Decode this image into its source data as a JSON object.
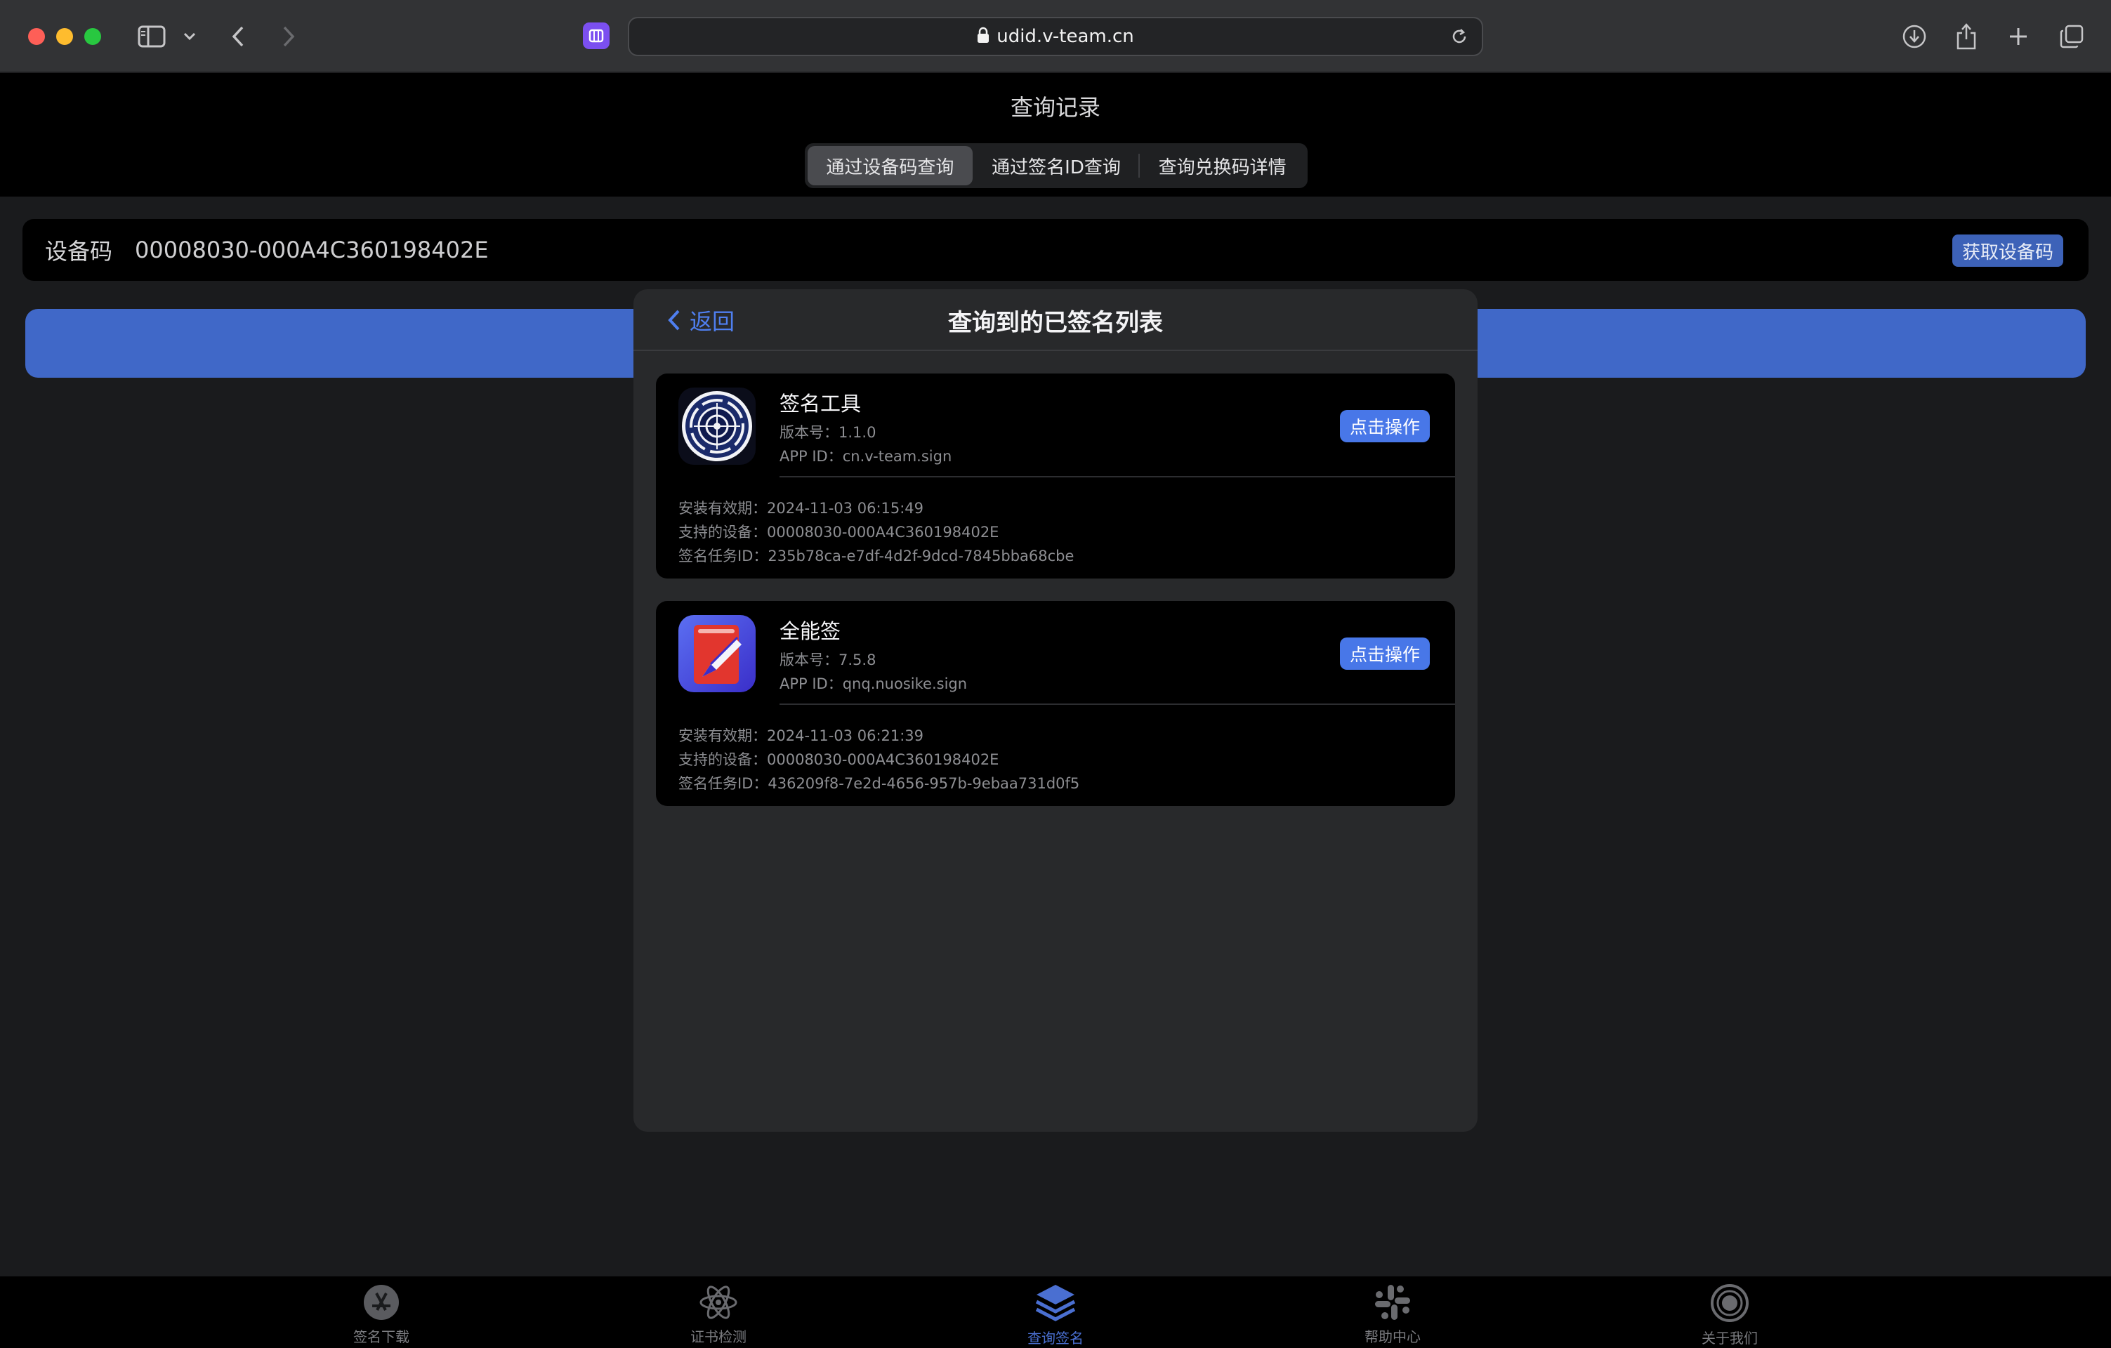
{
  "browser": {
    "url": "udid.v-team.cn",
    "icons": [
      "sidebar-icon",
      "chevron-down-icon",
      "back-arrow-icon",
      "forward-arrow-icon",
      "extension-icon",
      "lock-icon",
      "reload-icon",
      "download-icon",
      "share-icon",
      "new-tab-icon",
      "tabs-overview-icon"
    ]
  },
  "page": {
    "title": "查询记录",
    "tabs": [
      {
        "label": "通过设备码查询",
        "active": true
      },
      {
        "label": "通过签名ID查询",
        "active": false
      },
      {
        "label": "查询兑换码详情",
        "active": false
      }
    ]
  },
  "device": {
    "label": "设备码",
    "value": "00008030-000A4C360198402E",
    "get_button": "获取设备码"
  },
  "modal": {
    "back_label": "返回",
    "title": "查询到的已签名列表",
    "apps": [
      {
        "name": "签名工具",
        "version": "版本号：1.1.0",
        "app_id": "APP ID：cn.v-team.sign",
        "button": "点击操作",
        "expiry": "安装有效期：2024-11-03 06:15:49",
        "device": "支持的设备：00008030-000A4C360198402E",
        "task_id": "签名任务ID：235b78ca-e7df-4d2f-9dcd-7845bba68cbe"
      },
      {
        "name": "全能签",
        "version": "版本号：7.5.8",
        "app_id": "APP ID：qnq.nuosike.sign",
        "button": "点击操作",
        "expiry": "安装有效期：2024-11-03 06:21:39",
        "device": "支持的设备：00008030-000A4C360198402E",
        "task_id": "签名任务ID：436209f8-7e2d-4656-957b-9ebaa731d0f5"
      }
    ]
  },
  "tabbar": {
    "items": [
      {
        "label": "签名下载",
        "icon": "app-store-icon"
      },
      {
        "label": "证书检测",
        "icon": "atom-icon"
      },
      {
        "label": "查询签名",
        "icon": "layers-icon",
        "active": true
      },
      {
        "label": "帮助中心",
        "icon": "slack-icon"
      },
      {
        "label": "关于我们",
        "icon": "target-icon"
      }
    ]
  },
  "colors": {
    "accent": "#4877e8",
    "blue_bar": "#4068c8",
    "modal_bg": "#28292b",
    "page_bg": "#1a1b1d"
  }
}
